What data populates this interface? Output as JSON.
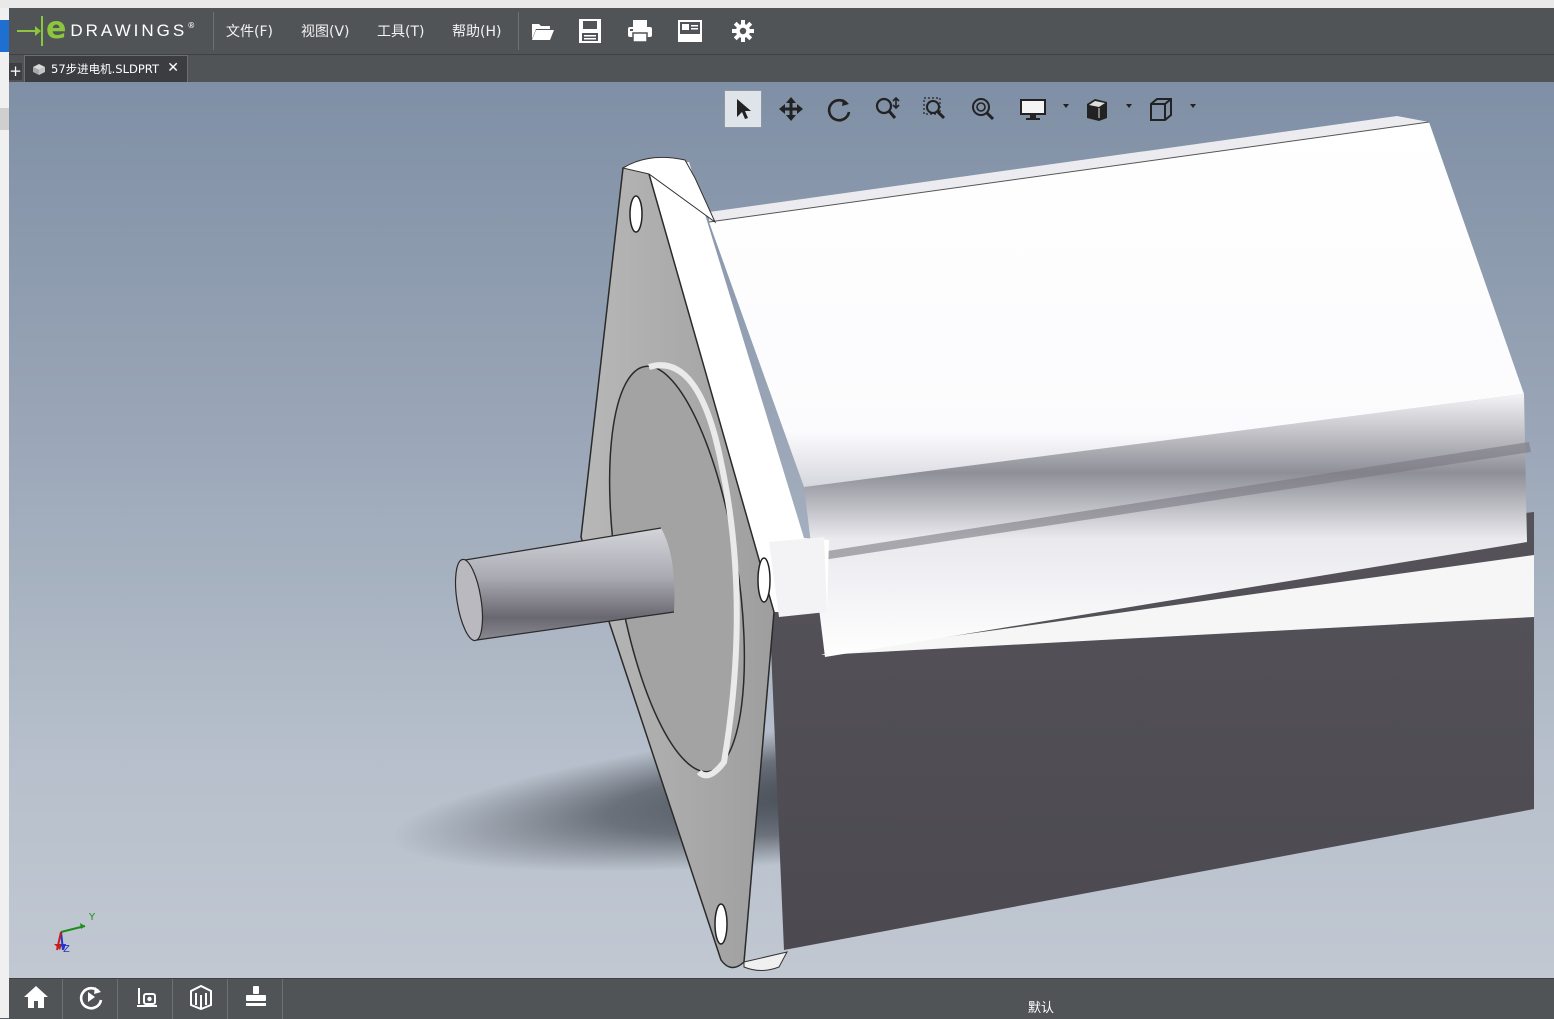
{
  "app": {
    "logo_e": "e",
    "logo_word": "DRAWINGS",
    "logo_reg": "®"
  },
  "menu": {
    "items": [
      {
        "label": "文件(F)"
      },
      {
        "label": "视图(V)"
      },
      {
        "label": "工具(T)"
      },
      {
        "label": "帮助(H)"
      }
    ]
  },
  "toolbar": {
    "icons": [
      "open-icon",
      "save-icon",
      "print-icon",
      "publish-icon",
      "settings-icon"
    ]
  },
  "tabs": {
    "new_tab_symbol": "+",
    "items": [
      {
        "label": "57步进电机.SLDPRT",
        "close_symbol": "✕"
      }
    ]
  },
  "hud": {
    "icons": [
      "select-icon",
      "pan-icon",
      "rotate-icon",
      "zoom-icon",
      "zoom-to-area-icon",
      "zoom-to-fit-icon",
      "display-style-icon",
      "section-view-icon",
      "view-orientation-icon"
    ],
    "active": "select-icon"
  },
  "triad": {
    "y_label": "Y",
    "z_label": "Z"
  },
  "bottom": {
    "icons": [
      "home-icon",
      "animate-icon",
      "measure-icon",
      "components-icon",
      "stamp-icon"
    ],
    "configuration": "默认"
  },
  "colors": {
    "chrome": "#515457",
    "accent_green": "#8cc63f",
    "viewport_top": "#7f8fa5",
    "viewport_bottom": "#c1c8d2"
  }
}
